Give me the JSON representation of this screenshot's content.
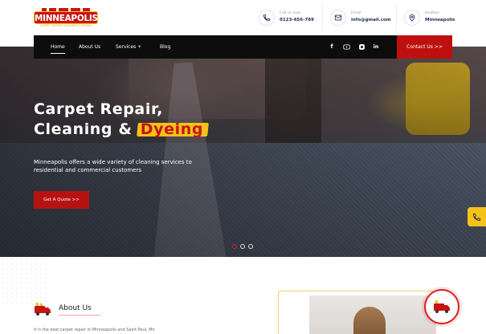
{
  "brand": {
    "name": "MINNEAPOLIS",
    "tagline": "CARPET REPAIR CLEANING & DYEING",
    "accent": "#c81414",
    "highlight": "#f3c319",
    "dark": "#0d0d0d"
  },
  "header": {
    "contacts": [
      {
        "label": "Call us now",
        "value": "0123-456-789",
        "icon": "phone-icon"
      },
      {
        "label": "Email",
        "value": "info@gmail.com",
        "icon": "mail-icon"
      },
      {
        "label": "location",
        "value": "Minneapolis",
        "icon": "location-icon"
      }
    ]
  },
  "nav": {
    "items": [
      {
        "label": "Home",
        "active": true
      },
      {
        "label": "About Us",
        "active": false
      },
      {
        "label": "Services +",
        "active": false
      },
      {
        "label": "Blog",
        "active": false
      }
    ],
    "social": [
      "facebook-icon",
      "youtube-icon",
      "instagram-icon",
      "linkedin-icon"
    ],
    "social_text": {
      "facebook": "f",
      "linkedin": "in"
    },
    "cta": "Contact Us  >>"
  },
  "hero": {
    "title_line1": "Carpet Repair,",
    "title_line2_prefix": "Cleaning & ",
    "title_highlight": "Dyeing",
    "subtitle": "Minneapolis offers a wide variety of cleaning services to residential and commercial customers",
    "button": "Get A Quote  >>",
    "slides": 3,
    "active_slide": 1
  },
  "about": {
    "title": "About Us",
    "text": "It is the best carpet repair in Minneapolis and Saint Paul, Mn"
  }
}
